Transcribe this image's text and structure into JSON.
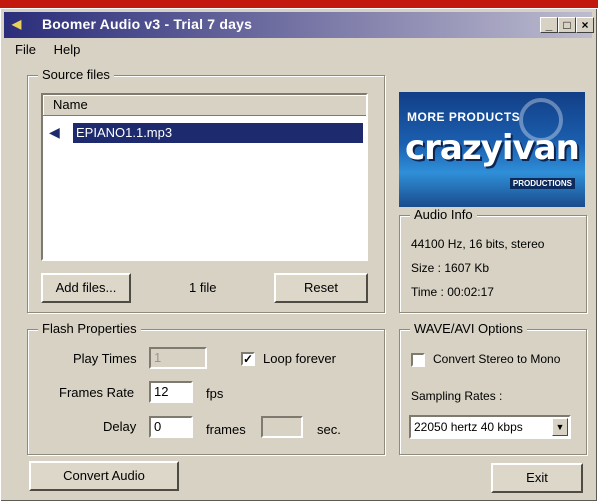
{
  "window": {
    "title": "Boomer Audio v3 - Trial 7 days"
  },
  "menu": {
    "file": "File",
    "help": "Help"
  },
  "source": {
    "legend": "Source files",
    "column_name": "Name",
    "files": [
      {
        "name": "EPIANO1.1.mp3",
        "selected": true
      }
    ],
    "add_button": "Add files...",
    "count": "1 file",
    "reset_button": "Reset"
  },
  "logo": {
    "top": "MORE PRODUCTS",
    "brand": "crazyivan",
    "sub": "PRODUCTIONS"
  },
  "audio_info": {
    "legend": "Audio Info",
    "format": "44100 Hz, 16 bits, stereo",
    "size": "Size :  1607 Kb",
    "time": "Time :  00:02:17"
  },
  "flash": {
    "legend": "Flash Properties",
    "play_times_label": "Play Times",
    "play_times_value": "1",
    "loop_label": "Loop forever",
    "loop_checked": true,
    "frames_rate_label": "Frames Rate",
    "frames_rate_value": "12",
    "fps_unit": "fps",
    "delay_label": "Delay",
    "delay_value": "0",
    "frames_unit": "frames",
    "sec_value": "",
    "sec_unit": "sec."
  },
  "wave": {
    "legend": "WAVE/AVI Options",
    "convert_label": "Convert Stereo to Mono",
    "convert_checked": false,
    "sampling_label": "Sampling Rates :",
    "sampling_value": "22050 hertz 40 kbps"
  },
  "buttons": {
    "convert": "Convert Audio",
    "exit": "Exit"
  },
  "colors": {
    "selection": "#1d2a6e",
    "titlebar_start": "#2a2d7a"
  }
}
